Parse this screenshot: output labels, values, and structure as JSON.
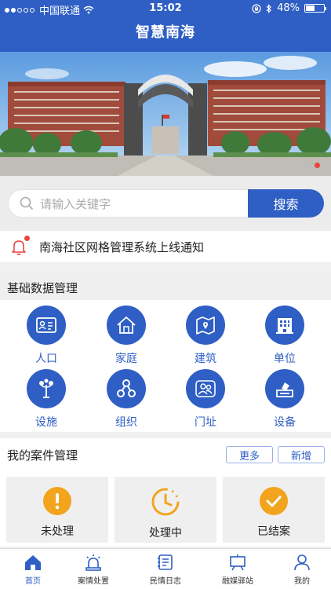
{
  "status": {
    "carrier": "中国联通",
    "time": "15:02",
    "battery": "48%",
    "battery_level": 0.48
  },
  "nav": {
    "title": "智慧南海"
  },
  "banner": {
    "pages": 2,
    "current": 1
  },
  "search": {
    "placeholder": "请输入关键字",
    "button": "搜索"
  },
  "notice": {
    "text": "南海社区网格管理系统上线通知"
  },
  "basic": {
    "title": "基础数据管理",
    "items": [
      {
        "label": "人口",
        "icon": "id-card-icon"
      },
      {
        "label": "家庭",
        "icon": "home-icon"
      },
      {
        "label": "建筑",
        "icon": "map-icon"
      },
      {
        "label": "单位",
        "icon": "building-icon"
      },
      {
        "label": "设施",
        "icon": "streetlamp-icon"
      },
      {
        "label": "组织",
        "icon": "organization-icon"
      },
      {
        "label": "门址",
        "icon": "people-icon"
      },
      {
        "label": "设备",
        "icon": "device-icon"
      }
    ]
  },
  "cases": {
    "title": "我的案件管理",
    "more": "更多",
    "add": "新增",
    "cards": [
      {
        "label": "未处理",
        "icon": "exclamation-icon"
      },
      {
        "label": "处理中",
        "icon": "clock-icon"
      },
      {
        "label": "已结案",
        "icon": "check-icon"
      }
    ]
  },
  "tabs": [
    {
      "label": "首页",
      "icon": "home-icon",
      "active": true
    },
    {
      "label": "案情处置",
      "icon": "alarm-icon"
    },
    {
      "label": "民情日志",
      "icon": "log-icon"
    },
    {
      "label": "融媒驿站",
      "icon": "media-icon"
    },
    {
      "label": "我的",
      "icon": "user-icon"
    }
  ],
  "colors": {
    "primary": "#2f5fc4",
    "warning": "#f2a41d",
    "alert": "#e94545"
  }
}
